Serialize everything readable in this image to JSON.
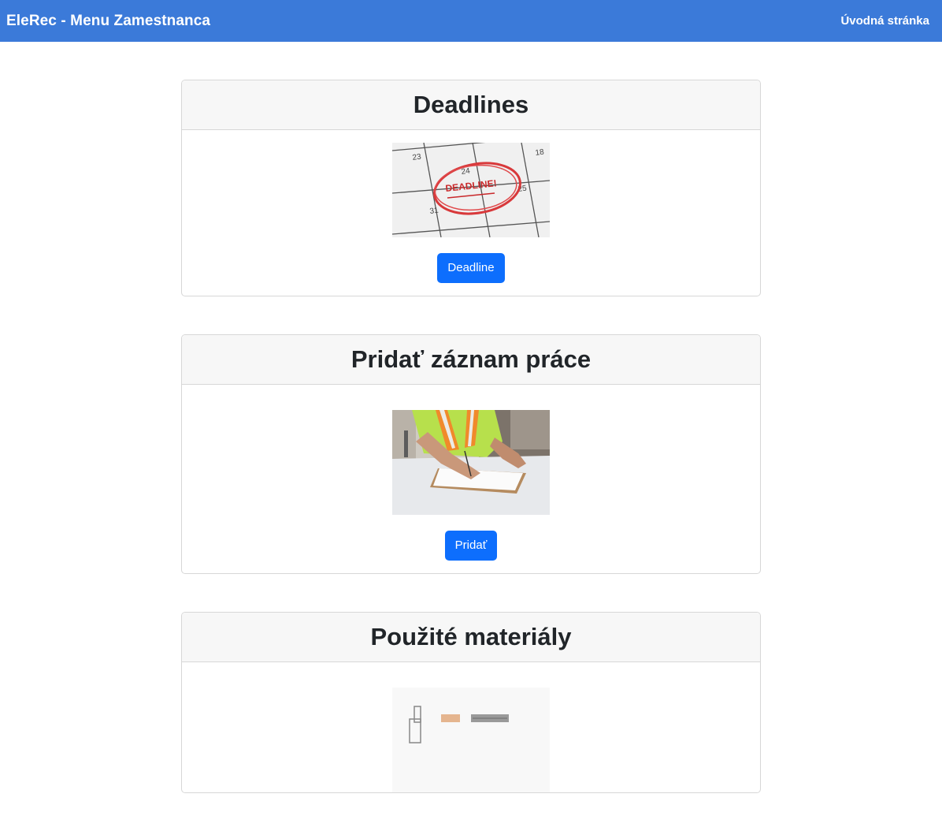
{
  "navbar": {
    "brand": "EleRec - Menu Zamestnanca",
    "home_link": "Úvodná stránka",
    "color": "#3b7ad9"
  },
  "cards": [
    {
      "title": "Deadlines",
      "image": {
        "name": "calendar-deadline-image",
        "days": [
          "23",
          "24",
          "25",
          "31",
          "18"
        ],
        "stamp": "DEADLINE!"
      },
      "button": "Deadline"
    },
    {
      "title": "Pridať záznam práce",
      "image": {
        "name": "worker-writing-clipboard-image"
      },
      "button": "Pridať"
    },
    {
      "title": "Použité materiály",
      "image": {
        "name": "materials-image"
      }
    }
  ],
  "colors": {
    "primary_button": "#0d6efd",
    "card_header_bg": "#f7f7f7",
    "card_border": "#d7d7d7"
  }
}
